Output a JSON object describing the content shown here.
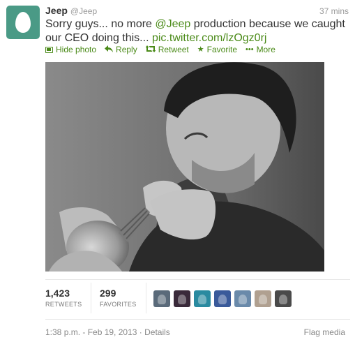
{
  "author": {
    "fullname": "Jeep",
    "username": "@Jeep",
    "avatar_icon": "egg-avatar-icon",
    "avatar_color": "#4a9a86"
  },
  "tweet": {
    "time": "37 mins",
    "text_before": "Sorry guys... no more ",
    "mention": "@Jeep",
    "text_middle": " production because we caught our CEO doing this... ",
    "link": "pic.twitter.com/lzOgz0rj",
    "link_color": "#4a8a18"
  },
  "actions": {
    "hide_photo": "Hide photo",
    "reply": "Reply",
    "retweet": "Retweet",
    "favorite": "Favorite",
    "more": "More"
  },
  "stats": {
    "retweets_count": "1,423",
    "retweets_label": "RETWEETS",
    "favorites_count": "299",
    "favorites_label": "FAVORITES"
  },
  "favoriters": [
    {
      "name": "favoriter-avatar-1",
      "color": "#5a6a7a"
    },
    {
      "name": "favoriter-avatar-2",
      "color": "#3a2a3a"
    },
    {
      "name": "favoriter-avatar-3",
      "color": "#2a8aa0"
    },
    {
      "name": "favoriter-avatar-4",
      "color": "#3a5a9a"
    },
    {
      "name": "favoriter-avatar-5",
      "color": "#6a8aaa"
    },
    {
      "name": "favoriter-avatar-6",
      "color": "#b0a090"
    },
    {
      "name": "favoriter-avatar-7",
      "color": "#4a4a4a"
    }
  ],
  "footer": {
    "timestamp": "1:38 p.m. - Feb 19, 2013",
    "separator": "·",
    "details": "Details",
    "flag_media": "Flag media"
  }
}
